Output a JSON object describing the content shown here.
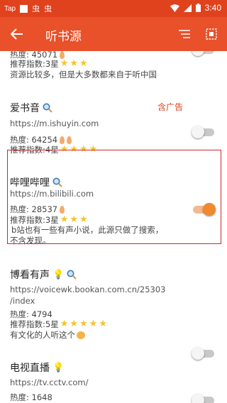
{
  "statusbar": {
    "app_label": "Tap",
    "glyph1": "虫",
    "glyph2": "虫",
    "time": "3:40"
  },
  "appbar": {
    "title": "听书源"
  },
  "sources": [
    {
      "name": "",
      "url": "",
      "heat": "热度: 45071",
      "flames": 1,
      "rating": "推荐指数:3星",
      "stars": 3,
      "desc": "资源比较多，但是大多数都来自于听中国",
      "enabled": false
    },
    {
      "name": "爱书音",
      "url": "https://m.ishuyin.com",
      "ad": "含广告",
      "heat": "热度: 64254",
      "flames": 2,
      "rating": "推荐指数:4星",
      "stars": 4,
      "enabled": false
    },
    {
      "name": "哔哩哔哩",
      "url": "https://m.bilibili.com",
      "heat": "热度: 28537",
      "flames": 1,
      "rating": "推荐指数:3星",
      "stars": 3,
      "desc1": "b站也有一些有声小说，此源只做了搜索，",
      "desc2": "不含发现。",
      "enabled": true
    },
    {
      "name": "博看有声",
      "url1": "https://voicewk.bookan.com.cn/25303",
      "url2": "/index",
      "heat": "热度: 4794",
      "flames": 0,
      "rating": "推荐指数:5星",
      "stars": 5,
      "desc": "有文化的人听这个",
      "enabled": false
    },
    {
      "name": "电视直播",
      "url": "https://tv.cctv.com/",
      "heat": "热度: 1648",
      "enabled": false
    }
  ],
  "colors": {
    "statusbar": "#e0421e",
    "appbar": "#e8512a",
    "accent": "#f08a2c",
    "ad": "#e0421e",
    "highlight": "#d0262c"
  }
}
